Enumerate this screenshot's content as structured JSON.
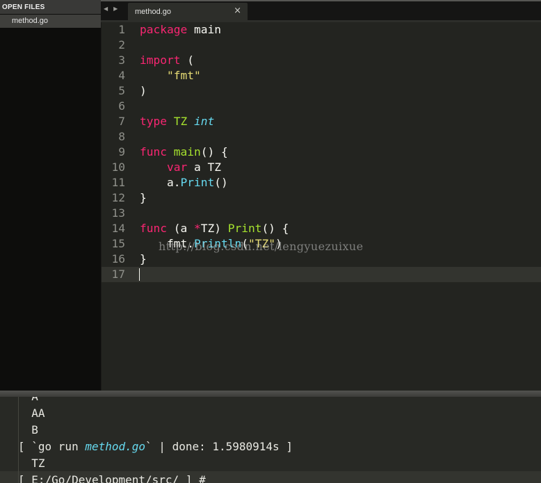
{
  "sidebar": {
    "header": "OPEN FILES",
    "files": [
      {
        "name": "method.go"
      }
    ]
  },
  "tabs": {
    "nav_prev": "◀",
    "nav_next": "▶",
    "active": {
      "label": "method.go",
      "close": "×"
    }
  },
  "editor": {
    "watermark": "http://blog.csdn.net/lengyuezuixue",
    "active_line": 17,
    "lines": [
      {
        "num": "1",
        "tokens": [
          {
            "t": "package",
            "c": "kw"
          },
          {
            "t": " main",
            "c": ""
          }
        ]
      },
      {
        "num": "2",
        "tokens": []
      },
      {
        "num": "3",
        "tokens": [
          {
            "t": "import",
            "c": "kw"
          },
          {
            "t": " (",
            "c": ""
          }
        ]
      },
      {
        "num": "4",
        "tokens": [
          {
            "t": "    ",
            "c": ""
          },
          {
            "t": "\"fmt\"",
            "c": "st"
          }
        ]
      },
      {
        "num": "5",
        "tokens": [
          {
            "t": ")",
            "c": ""
          }
        ]
      },
      {
        "num": "6",
        "tokens": []
      },
      {
        "num": "7",
        "tokens": [
          {
            "t": "type",
            "c": "kw"
          },
          {
            "t": " ",
            "c": ""
          },
          {
            "t": "TZ",
            "c": "fn"
          },
          {
            "t": " ",
            "c": ""
          },
          {
            "t": "int",
            "c": "ty"
          }
        ]
      },
      {
        "num": "8",
        "tokens": []
      },
      {
        "num": "9",
        "tokens": [
          {
            "t": "func",
            "c": "kw"
          },
          {
            "t": " ",
            "c": ""
          },
          {
            "t": "main",
            "c": "fn"
          },
          {
            "t": "() {",
            "c": ""
          }
        ]
      },
      {
        "num": "10",
        "tokens": [
          {
            "t": "    ",
            "c": ""
          },
          {
            "t": "var",
            "c": "kw"
          },
          {
            "t": " a TZ",
            "c": ""
          }
        ]
      },
      {
        "num": "11",
        "tokens": [
          {
            "t": "    a.",
            "c": ""
          },
          {
            "t": "Print",
            "c": "call"
          },
          {
            "t": "()",
            "c": ""
          }
        ]
      },
      {
        "num": "12",
        "tokens": [
          {
            "t": "}",
            "c": ""
          }
        ]
      },
      {
        "num": "13",
        "tokens": []
      },
      {
        "num": "14",
        "tokens": [
          {
            "t": "func",
            "c": "kw"
          },
          {
            "t": " (a ",
            "c": ""
          },
          {
            "t": "*",
            "c": "kw"
          },
          {
            "t": "TZ) ",
            "c": ""
          },
          {
            "t": "Print",
            "c": "fn"
          },
          {
            "t": "() {",
            "c": ""
          }
        ]
      },
      {
        "num": "15",
        "tokens": [
          {
            "t": "    fmt.",
            "c": ""
          },
          {
            "t": "Println",
            "c": "call"
          },
          {
            "t": "(",
            "c": ""
          },
          {
            "t": "\"TZ\"",
            "c": "st"
          },
          {
            "t": ")",
            "c": ""
          }
        ]
      },
      {
        "num": "16",
        "tokens": [
          {
            "t": "}",
            "c": ""
          }
        ]
      },
      {
        "num": "17",
        "tokens": []
      }
    ]
  },
  "console": {
    "lines": [
      {
        "text": "  A",
        "partial": true
      },
      {
        "text": "  AA"
      },
      {
        "text": "  B"
      },
      {
        "pre": "[ `go run ",
        "em": "method.go",
        "post": "` | done: 1.5980914s ]"
      },
      {
        "text": "  TZ"
      },
      {
        "text": "[ E:/Go/Development/src/ ] #",
        "prompt": true
      }
    ]
  },
  "colors": {
    "keyword": "#f92672",
    "function": "#a6e22e",
    "type": "#66d9ef",
    "string": "#e6db74",
    "background": "#232420"
  }
}
